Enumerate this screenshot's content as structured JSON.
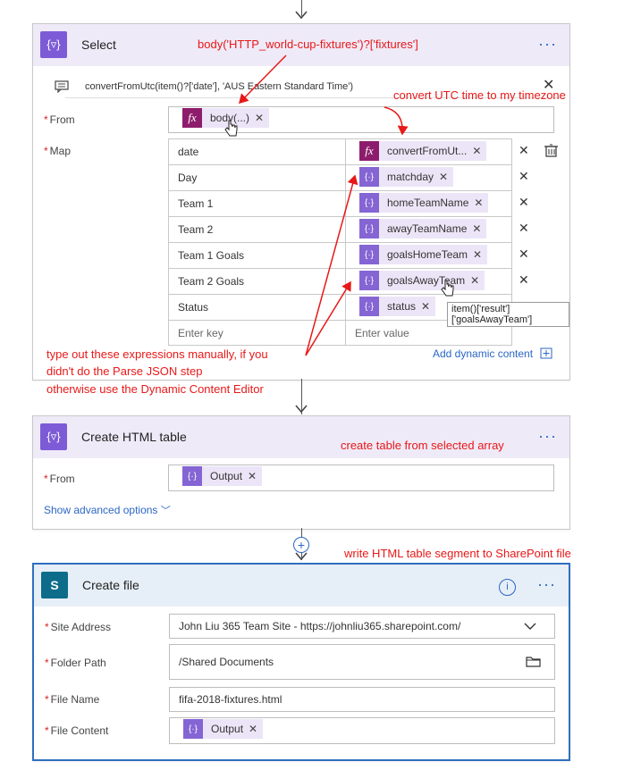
{
  "select_card": {
    "title": "Select",
    "comment_text": "convertFromUtc(item()?['date'], 'AUS Eastern Standard Time')",
    "from_label": "From",
    "from_token": "body(...)",
    "map_label": "Map",
    "map_rows": [
      {
        "key": "date",
        "value": "convertFromUt...",
        "icon": "fx-icon"
      },
      {
        "key": "Day",
        "value": "matchday",
        "icon": "expression-icon"
      },
      {
        "key": "Team 1",
        "value": "homeTeamName",
        "icon": "expression-icon"
      },
      {
        "key": "Team 2",
        "value": "awayTeamName",
        "icon": "expression-icon"
      },
      {
        "key": "Team 1 Goals",
        "value": "goalsHomeTeam",
        "icon": "expression-icon"
      },
      {
        "key": "Team 2 Goals",
        "value": "goalsAwayTeam",
        "icon": "expression-icon"
      },
      {
        "key": "Status",
        "value": "status",
        "icon": "expression-icon"
      }
    ],
    "enter_key_placeholder": "Enter key",
    "enter_value_placeholder": "Enter value",
    "tooltip": "item()['result']['goalsAwayTeam']",
    "add_dynamic_content": "Add dynamic content"
  },
  "html_card": {
    "title": "Create HTML table",
    "from_label": "From",
    "from_token": "Output",
    "advanced": "Show advanced options"
  },
  "file_card": {
    "title": "Create file",
    "fields": [
      {
        "label": "Site Address",
        "value": "John Liu 365 Team Site - https://johnliu365.sharepoint.com/"
      },
      {
        "label": "Folder Path",
        "value": "/Shared Documents"
      },
      {
        "label": "File Name",
        "value": "fifa-2018-fixtures.html"
      },
      {
        "label": "File Content",
        "value": "Output"
      }
    ]
  },
  "annotations": {
    "body_expr": "body('HTTP_world-cup-fixtures')?['fixtures']",
    "convert_utc": "convert UTC time to my timezone",
    "manual_1": "type out these expressions manually, if you",
    "manual_2": "didn't do the Parse JSON step",
    "manual_3": "otherwise use the Dynamic Content Editor",
    "create_table": "create table from selected array",
    "write_html": "write HTML table segment to SharePoint file"
  },
  "colors": {
    "accent": "#7d5bd7",
    "fx": "#8d1d6c",
    "annotation": "#e81818",
    "link": "#2b66c3",
    "sharepoint": "#0c6c8a"
  }
}
